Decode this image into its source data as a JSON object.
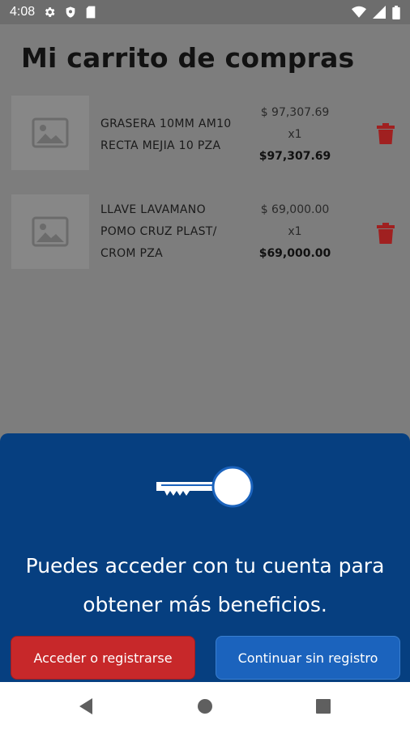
{
  "status_bar": {
    "time": "4:08",
    "left_icons": [
      "gear-icon",
      "shield-icon",
      "sim-card-icon"
    ],
    "right_icons": [
      "wifi-icon",
      "signal-icon",
      "battery-icon"
    ]
  },
  "page": {
    "title": "Mi carrito de compras"
  },
  "cart": {
    "items": [
      {
        "name_lines": [
          "GRASERA 10MM AM10",
          "RECTA MEJIA  10 PZA"
        ],
        "unit_price": "$ 97,307.69",
        "quantity": "x1",
        "total": "$97,307.69",
        "image_icon": "image-placeholder-icon",
        "delete_icon": "trash-icon"
      },
      {
        "name_lines": [
          "LLAVE LAVAMANO",
          "POMO CRUZ PLAST/",
          "CROM PZA"
        ],
        "unit_price": "$ 69,000.00",
        "quantity": "x1",
        "total": "$69,000.00",
        "image_icon": "image-placeholder-icon",
        "delete_icon": "trash-icon"
      }
    ]
  },
  "login_sheet": {
    "icon": "key-icon",
    "message": "Puedes acceder con tu cuenta para obtener más beneficios.",
    "login_button": "Acceder o registrarse",
    "guest_button": "Continuar sin registro",
    "colors": {
      "background": "#063f80",
      "login_button": "#c7282a",
      "guest_button": "#1b63bd"
    }
  },
  "nav_bar": {
    "icons": [
      "back-icon",
      "home-icon",
      "recents-icon"
    ]
  }
}
